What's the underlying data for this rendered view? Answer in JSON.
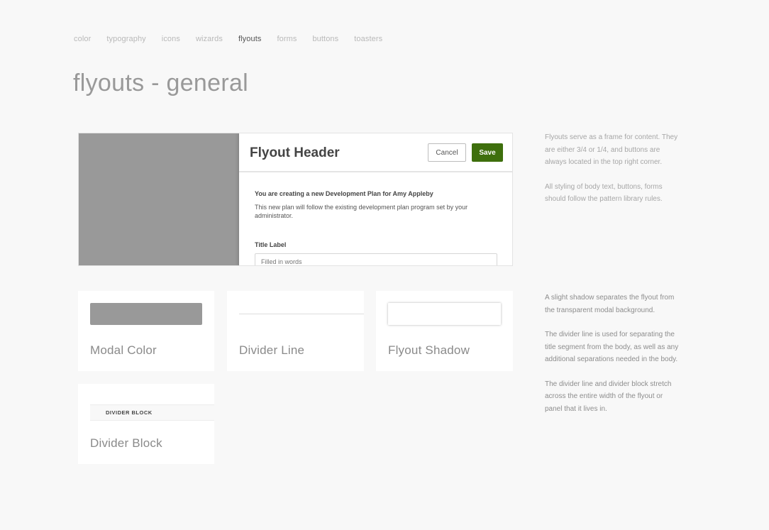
{
  "nav": {
    "items": [
      {
        "label": "color"
      },
      {
        "label": "typography"
      },
      {
        "label": "icons"
      },
      {
        "label": "wizards"
      },
      {
        "label": "flyouts"
      },
      {
        "label": "forms"
      },
      {
        "label": "buttons"
      },
      {
        "label": "toasters"
      }
    ],
    "active": "flyouts"
  },
  "page": {
    "title": "flyouts - general"
  },
  "demo": {
    "modal_color": "#999999",
    "flyout": {
      "header": "Flyout Header",
      "cancel_label": "Cancel",
      "save_label": "Save",
      "save_color": "#3e6f0d",
      "intro_title": "You are creating a new Development Plan for Amy Appleby",
      "intro_text": "This new plan will follow the existing development plan program set by your administrator.",
      "field_label": "Title Label",
      "field_placeholder": "Filled in words"
    }
  },
  "side_top": {
    "p1": "Flyouts serve as a frame for content. They are either 3/4 or 1/4, and buttons are always located in the top right corner.",
    "p2": "All styling of body text, buttons, forms should follow the pattern library rules."
  },
  "cards": {
    "modal_color": "Modal Color",
    "divider_line": "Divider Line",
    "flyout_shadow": "Flyout Shadow",
    "divider_block": "Divider Block",
    "divider_block_text": "DIVIDER BLOCK"
  },
  "side_bottom": {
    "p1": "A slight shadow separates the flyout from the transparent modal background.",
    "p2": "The divider line is used for separating the title segment from the body, as well as any additional separations needed in the body.",
    "p3": "The divider line and divider block stretch across the entire width of the flyout or panel that it lives in."
  }
}
